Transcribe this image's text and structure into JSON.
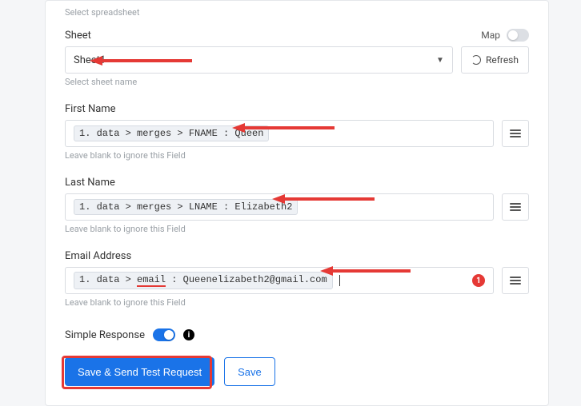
{
  "spreadsheet": {
    "helper": "Select spreadsheet"
  },
  "sheet": {
    "label": "Sheet",
    "map_label": "Map",
    "value": "Sheet1",
    "refresh": "Refresh",
    "helper": "Select sheet name"
  },
  "first_name": {
    "label": "First Name",
    "tag": "1. data > merges > FNAME : Queen",
    "helper": "Leave blank to ignore this Field"
  },
  "last_name": {
    "label": "Last Name",
    "tag": "1. data > merges > LNAME : Elizabeth2",
    "helper": "Leave blank to ignore this Field"
  },
  "email": {
    "label": "Email Address",
    "tag_prefix": "1. data > ",
    "tag_underline": "email",
    "tag_suffix": " : Queenelizabeth2@gmail.com",
    "badge": "1",
    "helper": "Leave blank to ignore this Field"
  },
  "simple_response": {
    "label": "Simple Response"
  },
  "buttons": {
    "primary": "Save & Send Test Request",
    "secondary": "Save"
  }
}
